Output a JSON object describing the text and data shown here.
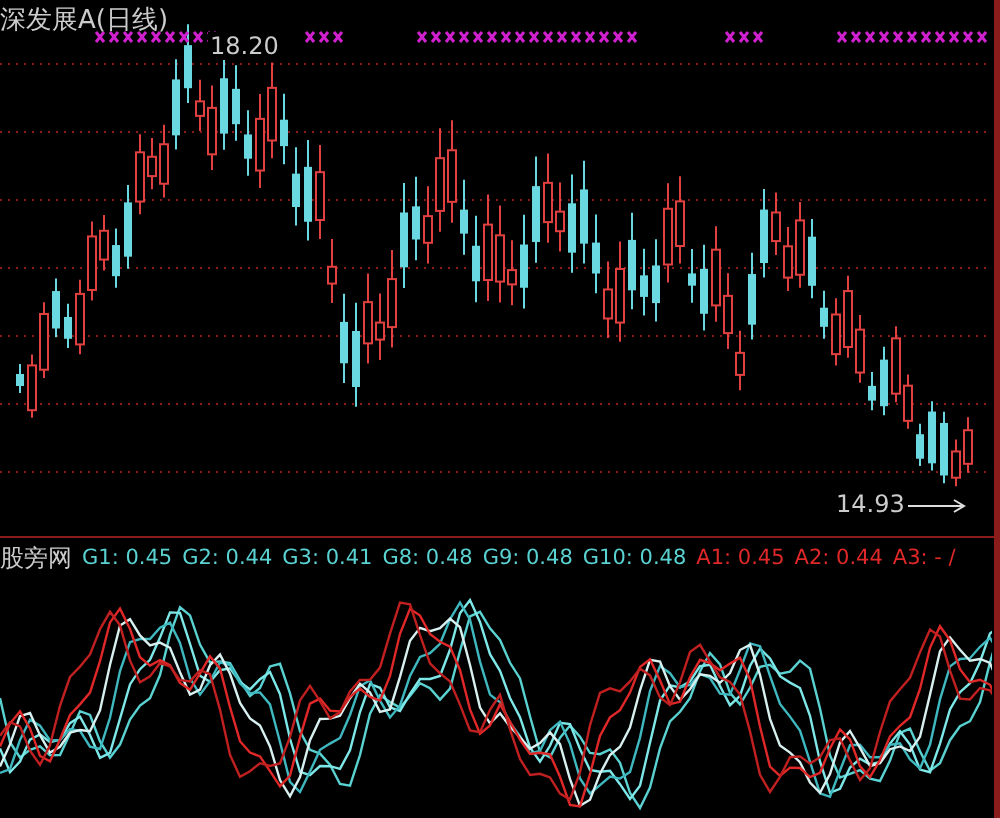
{
  "chart_title": "深发展A(日线)",
  "high_label": "18.20",
  "low_label": "14.93",
  "indicator": {
    "name": "股旁网",
    "values": [
      {
        "text": "G1: 0.45",
        "color": "#5ad2d2"
      },
      {
        "text": "G2: 0.44",
        "color": "#5ad2d2"
      },
      {
        "text": "G3: 0.41",
        "color": "#5ad2d2"
      },
      {
        "text": "G8: 0.48",
        "color": "#5ad2d2"
      },
      {
        "text": "G9: 0.48",
        "color": "#5ad2d2"
      },
      {
        "text": "G10: 0.48",
        "color": "#5ad2d2"
      },
      {
        "text": "A1: 0.45",
        "color": "#e02828"
      },
      {
        "text": "A2: 0.44",
        "color": "#e02828"
      },
      {
        "text": "A3: - /",
        "color": "#e02828"
      }
    ]
  }
}
